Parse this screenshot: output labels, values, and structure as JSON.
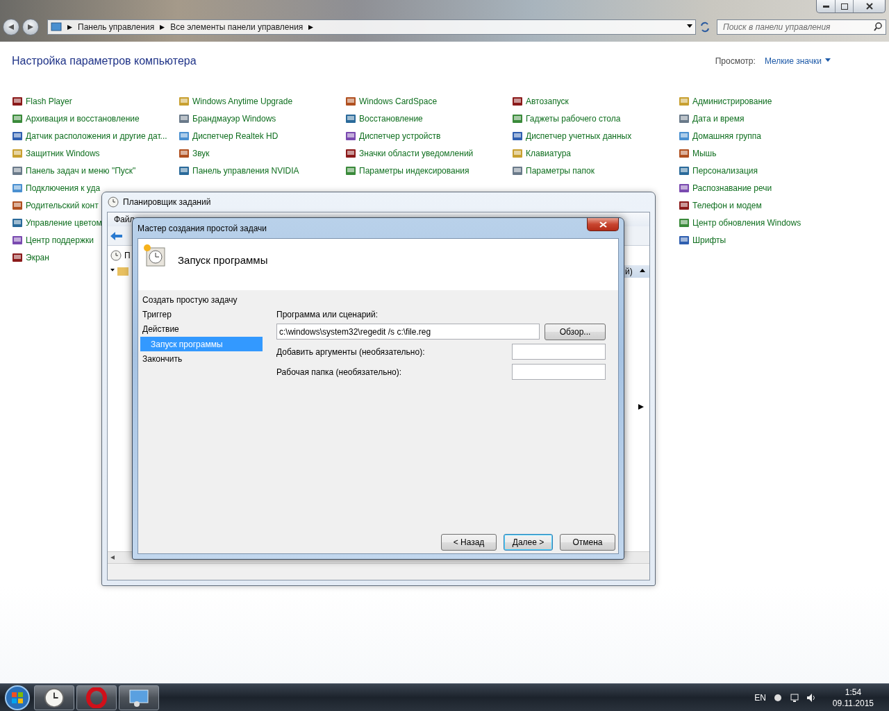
{
  "explorer": {
    "breadcrumbs": [
      "Панель управления",
      "Все элементы панели управления"
    ],
    "search": {
      "placeholder": "Поиск в панели управления"
    },
    "heading": "Настройка параметров компьютера",
    "view_label": "Просмотр:",
    "view_value": "Мелкие значки",
    "applet_columns": [
      [
        "Flash Player",
        "Архивация и восстановление",
        "Датчик расположения и другие дат...",
        "Защитник Windows",
        "Панель задач и меню \"Пуск\"",
        "Подключения к уда",
        "Родительский конт",
        "Управление цветом",
        "Центр поддержки",
        "Экран"
      ],
      [
        "Windows Anytime Upgrade",
        "Брандмауэр Windows",
        "Диспетчер Realtek HD",
        "Звук",
        "Панель управления NVIDIA"
      ],
      [
        "Windows CardSpace",
        "Восстановление",
        "Диспетчер устройств",
        "Значки области уведомлений",
        "Параметры индексирования"
      ],
      [
        "Автозапуск",
        "Гаджеты рабочего стола",
        "Диспетчер учетных данных",
        "Клавиатура",
        "Параметры папок"
      ],
      [
        "Администрирование",
        "Дата и время",
        "Домашняя группа",
        "Мышь",
        "Персонализация",
        "Распознавание речи",
        "Телефон и модем",
        "Центр обновления Windows",
        "Шрифты"
      ]
    ]
  },
  "scheduler": {
    "title": "Планировщик заданий",
    "menu": [
      "Файл"
    ],
    "tree_root": "П",
    "column_header": "й)"
  },
  "wizard": {
    "title": "Мастер создания простой задачи",
    "header": "Запуск программы",
    "steps": [
      {
        "label": "Создать простую задачу",
        "selected": false
      },
      {
        "label": "Триггер",
        "selected": false
      },
      {
        "label": "Действие",
        "selected": false,
        "children": [
          {
            "label": "Запуск программы",
            "selected": true
          }
        ]
      },
      {
        "label": "Закончить",
        "selected": false
      }
    ],
    "program_label": "Программа или сценарий:",
    "program_value": "c:\\windows\\system32\\regedit /s c:\\file.reg",
    "browse_button": "Обзор...",
    "args_label": "Добавить аргументы (необязательно):",
    "workdir_label": "Рабочая папка (необязательно):",
    "buttons": [
      {
        "label": "< Назад",
        "default": false
      },
      {
        "label": "Далее >",
        "default": true
      },
      {
        "label": "Отмена",
        "default": false
      }
    ]
  },
  "taskbar": {
    "language": "EN",
    "time": "1:54",
    "date": "09.11.2015"
  }
}
